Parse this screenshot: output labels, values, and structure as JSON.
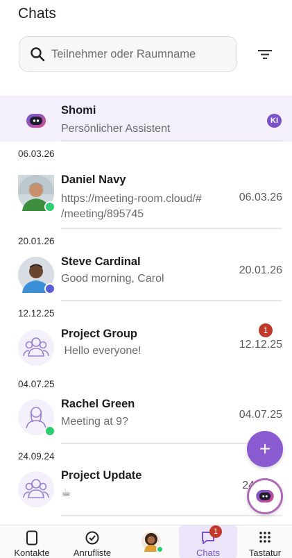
{
  "header": {
    "title": "Chats"
  },
  "search": {
    "placeholder": "Teilnehmer oder Raumname"
  },
  "assistant": {
    "name": "Shomi",
    "subtitle": "Persönlicher Assistent",
    "badge": "KI"
  },
  "chats": [
    {
      "section": "06.03.26",
      "name": "Daniel Navy",
      "preview": "https://meeting-room.cloud/#\n/meeting/895745",
      "date": "06.03.26",
      "status": "online"
    },
    {
      "section": "20.01.26",
      "name": "Steve Cardinal",
      "preview": "Good morning, Carol",
      "date": "20.01.26",
      "status": "busy"
    },
    {
      "section": "12.12.25",
      "name": "Project Group",
      "preview": " Hello everyone!",
      "date": "12.12.25",
      "unread": "1"
    },
    {
      "section": "04.07.25",
      "name": "Rachel Green",
      "preview": "Meeting at 9?",
      "date": "04.07.25",
      "status": "online"
    },
    {
      "section": "24.09.24",
      "name": "Project Update",
      "preview": "☕",
      "date": "24"
    }
  ],
  "fab": {
    "add_label": "+"
  },
  "nav": {
    "contacts": "Kontakte",
    "calls": "Anrufliste",
    "chats": "Chats",
    "chats_badge": "1",
    "keypad": "Tastatur"
  },
  "colors": {
    "accent": "#7b53c9",
    "online": "#2ecc71",
    "busy": "#5b5fd6",
    "unread": "#c0392b"
  }
}
